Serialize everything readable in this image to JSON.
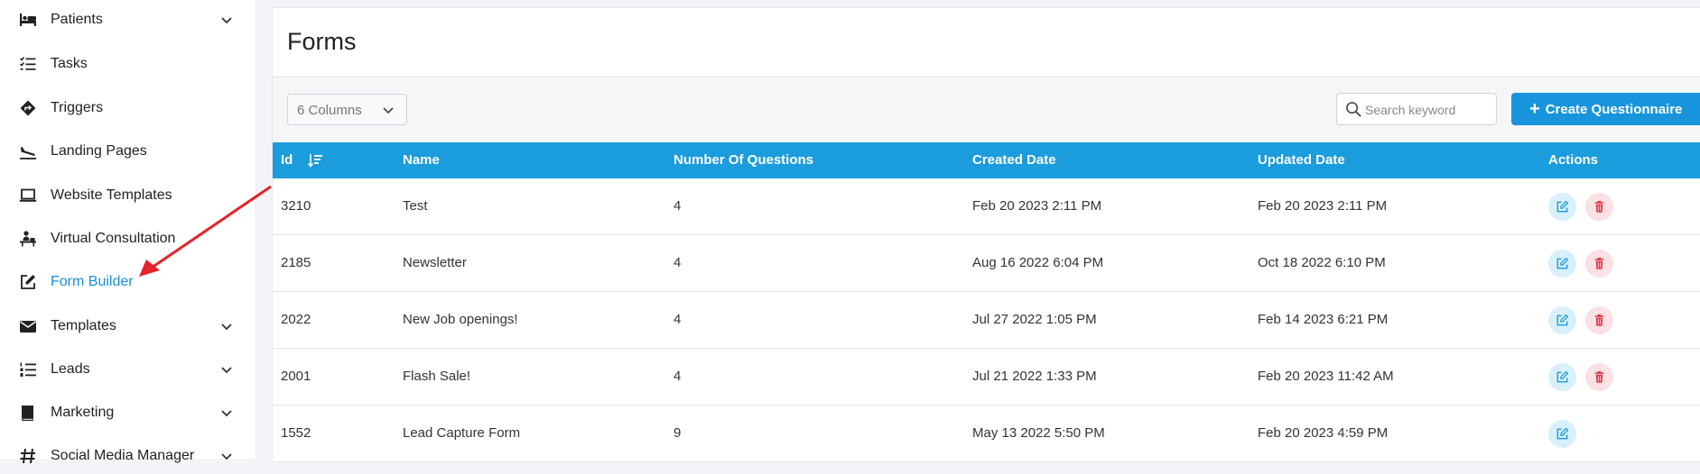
{
  "sidebar": {
    "items": [
      {
        "label": "Patients",
        "icon": "bed-icon",
        "has_chevron": true
      },
      {
        "label": "Tasks",
        "icon": "task-list-icon",
        "has_chevron": false
      },
      {
        "label": "Triggers",
        "icon": "diamond-direction-icon",
        "has_chevron": false
      },
      {
        "label": "Landing Pages",
        "icon": "plane-landing-icon",
        "has_chevron": false
      },
      {
        "label": "Website Templates",
        "icon": "laptop-icon",
        "has_chevron": false
      },
      {
        "label": "Virtual Consultation",
        "icon": "person-desk-icon",
        "has_chevron": false
      },
      {
        "label": "Form Builder",
        "icon": "edit-square-icon",
        "has_chevron": false,
        "active": true
      },
      {
        "label": "Templates",
        "icon": "envelope-icon",
        "has_chevron": true
      },
      {
        "label": "Leads",
        "icon": "numbered-list-icon",
        "has_chevron": true
      },
      {
        "label": "Marketing",
        "icon": "book-icon",
        "has_chevron": true
      },
      {
        "label": "Social Media Manager",
        "icon": "hashtag-icon",
        "has_chevron": true
      }
    ]
  },
  "page": {
    "title": "Forms"
  },
  "toolbar": {
    "columns_value": "6 Columns",
    "search_placeholder": "Search keyword",
    "create_label": "Create Questionnaire"
  },
  "table": {
    "headers": [
      "Id",
      "Name",
      "Number Of Questions",
      "Created Date",
      "Updated Date",
      "Actions"
    ],
    "rows": [
      {
        "id": "3210",
        "name": "Test",
        "questions": "4",
        "created": "Feb 20 2023 2:11 PM",
        "updated": "Feb 20 2023 2:11 PM",
        "can_delete": true
      },
      {
        "id": "2185",
        "name": "Newsletter",
        "questions": "4",
        "created": "Aug 16 2022 6:04 PM",
        "updated": "Oct 18 2022 6:10 PM",
        "can_delete": true
      },
      {
        "id": "2022",
        "name": "New Job openings!",
        "questions": "4",
        "created": "Jul 27 2022 1:05 PM",
        "updated": "Feb 14 2023 6:21 PM",
        "can_delete": true
      },
      {
        "id": "2001",
        "name": "Flash Sale!",
        "questions": "4",
        "created": "Jul 21 2022 1:33 PM",
        "updated": "Feb 20 2023 11:42 AM",
        "can_delete": true
      },
      {
        "id": "1552",
        "name": "Lead Capture Form",
        "questions": "9",
        "created": "May 13 2022 5:50 PM",
        "updated": "Feb 20 2023 4:59 PM",
        "can_delete": false
      }
    ]
  },
  "colors": {
    "accent": "#1794dc",
    "header_bg": "#1b9cdc",
    "active_link": "#1a8fd6",
    "annotation_arrow": "#e5222a",
    "delete_icon": "#e0333f"
  }
}
